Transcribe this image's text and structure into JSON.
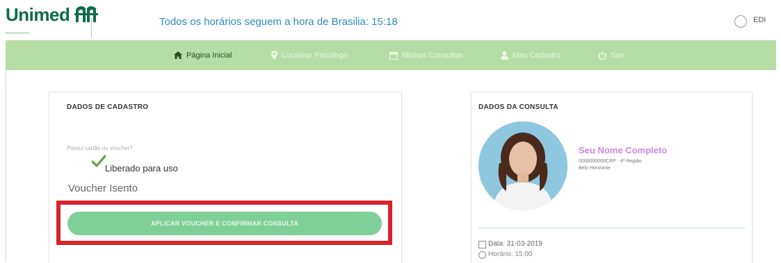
{
  "header": {
    "logo_text": "Unimed",
    "timezone_text": "Todos os horários seguem a hora de Brasilia: 15:18",
    "edit_label": "EDI"
  },
  "nav": {
    "items": [
      {
        "label": "Página Inicial",
        "icon": "home-icon"
      },
      {
        "label": "Localizar Psicólogo",
        "icon": "map-pin-icon"
      },
      {
        "label": "Minhas Consultas",
        "icon": "calendar-icon"
      },
      {
        "label": "Meu Cadastro",
        "icon": "user-icon"
      },
      {
        "label": "Sair",
        "icon": "power-icon"
      }
    ]
  },
  "cadastro": {
    "title": "DADOS DE CADASTRO",
    "question": "Possui cartão ou voucher?",
    "status": "Liberado para uso",
    "voucher": "Voucher Isento",
    "button_label": "APLICAR VOUCHER E CONFIRMAR CONSULTA"
  },
  "consulta": {
    "title": "DADOS DA CONSULTA",
    "name": "Seu Nome Completo",
    "crp": "0000000000CRP - 4ª Região",
    "city": "Belo Horizonte",
    "date": "Data: 31-03-2019",
    "hour": "Horário: 15:00"
  },
  "colors": {
    "brand_green": "#0e6b4c",
    "nav_bg": "#b6dea4",
    "button": "#7fcf98",
    "highlight": "#d9222a",
    "name_color": "#c98ad9"
  }
}
